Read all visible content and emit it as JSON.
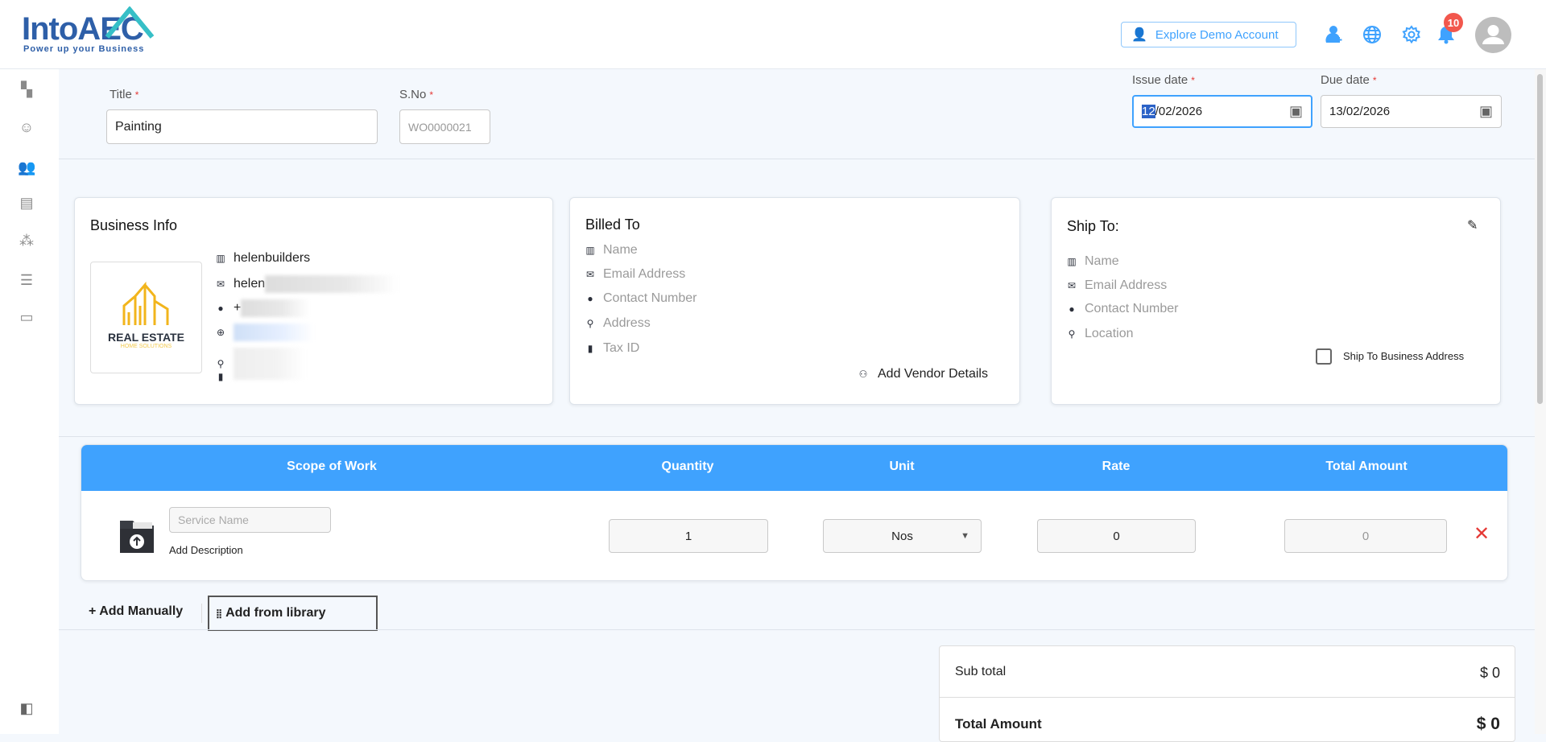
{
  "header": {
    "logo_text": "IntoAEC",
    "logo_tagline": "Power up your Business",
    "explore_label": "Explore Demo Account",
    "notification_count": "10"
  },
  "sidebar": {
    "items": [
      "dashboard-icon",
      "clients-icon",
      "team-icon",
      "invoice-icon",
      "modules-icon",
      "list-icon",
      "monitor-icon"
    ],
    "active_index": 2,
    "bottom": "layout-icon"
  },
  "form": {
    "title_label": "Title",
    "title_value": "Painting",
    "sno_label": "S.No",
    "sno_value": "WO0000021",
    "issue_label": "Issue date",
    "issue_day": "12",
    "issue_rest": "/02/2026",
    "due_label": "Due date",
    "due_value": "13/02/2026",
    "required_mark": "*"
  },
  "business": {
    "title": "Business Info",
    "name": "helenbuilders",
    "email_partial": "helen",
    "phone_partial": "+",
    "logo_text": "REAL ESTATE",
    "logo_sub": "HOME SOLUTIONS"
  },
  "billed": {
    "title": "Billed To",
    "fields": [
      "Name",
      "Email Address",
      "Contact Number",
      "Address",
      "Tax ID"
    ],
    "add_vendor": "Add Vendor Details"
  },
  "ship": {
    "title": "Ship To:",
    "fields": [
      "Name",
      "Email Address",
      "Contact Number",
      "Location"
    ],
    "checkbox_label": "Ship To Business Address",
    "checked": false
  },
  "table": {
    "headers": [
      "Scope of Work",
      "Quantity",
      "Unit",
      "Rate",
      "Total Amount"
    ],
    "row": {
      "service_placeholder": "Service Name",
      "add_description": "Add Description",
      "quantity": "1",
      "unit": "Nos",
      "rate": "0",
      "total": "0"
    }
  },
  "actions": {
    "add_manually": "+ Add Manually",
    "add_library": "Add from library"
  },
  "totals": {
    "subtotal_label": "Sub total",
    "subtotal_value": "$ 0",
    "total_label": "Total Amount",
    "total_value": "$ 0"
  },
  "colors": {
    "accent": "#3fa2fe",
    "brand_dark": "#2e5fa8",
    "brand_teal": "#36bfc7",
    "danger": "#e53935"
  }
}
